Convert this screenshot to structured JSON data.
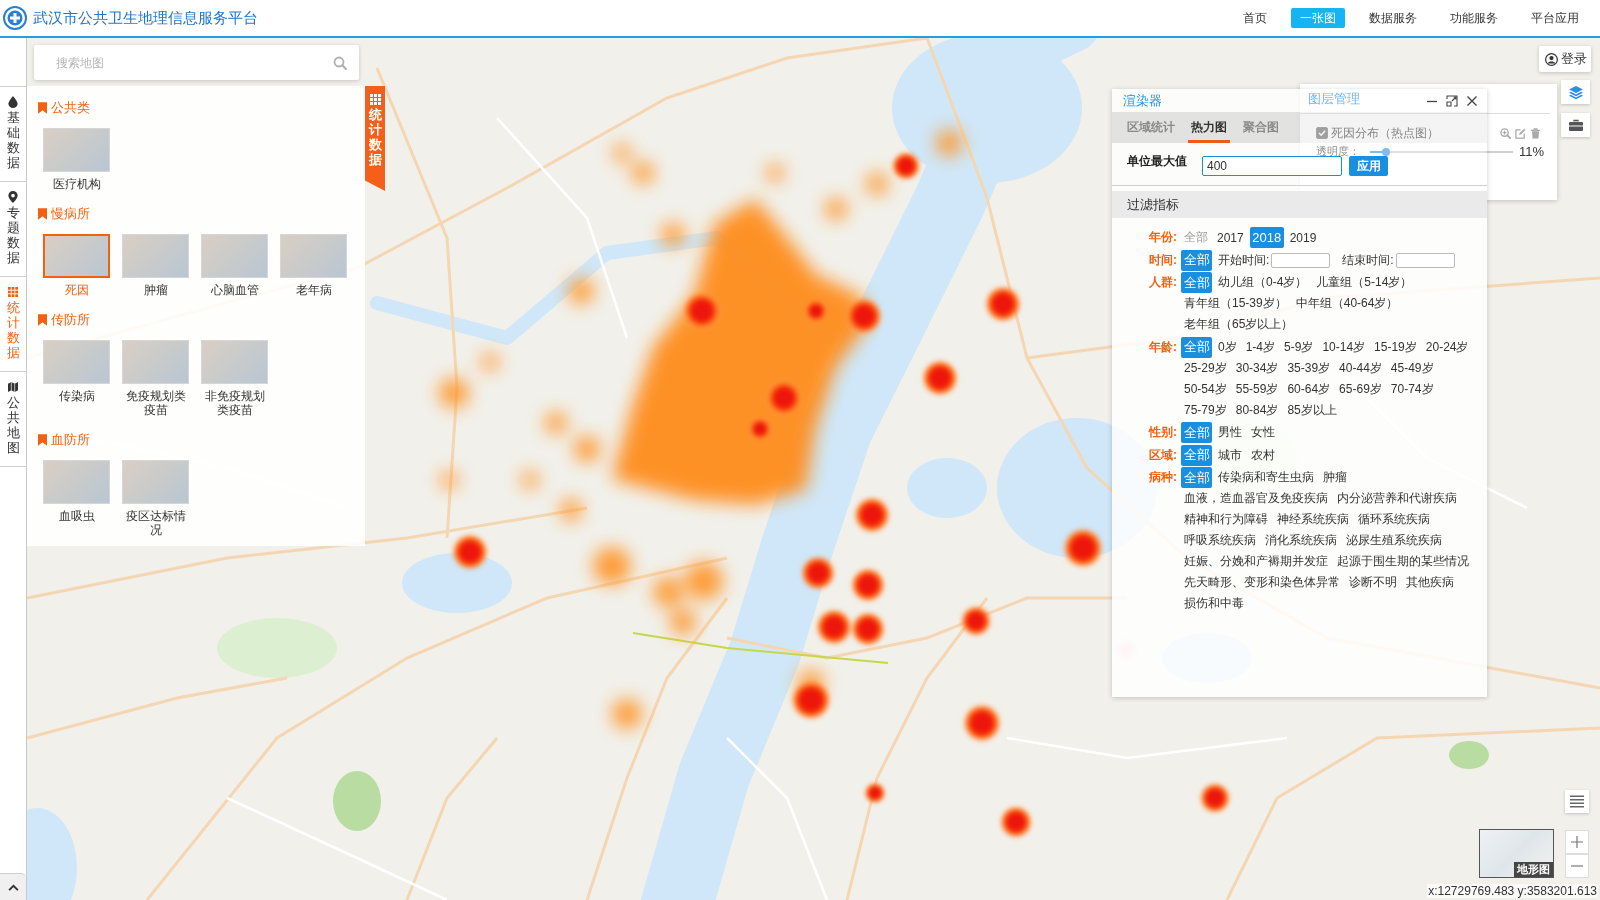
{
  "header": {
    "title": "武汉市公共卫生地理信息服务平台",
    "nav": [
      {
        "label": "首页",
        "selected": false
      },
      {
        "label": "一张图",
        "selected": true
      },
      {
        "label": "数据服务",
        "selected": false
      },
      {
        "label": "功能服务",
        "selected": false
      },
      {
        "label": "平台应用",
        "selected": false
      }
    ]
  },
  "sidebar": {
    "items": [
      {
        "kind": "drop",
        "label": "基础数据",
        "selected": false
      },
      {
        "kind": "pin",
        "label": "专题数据",
        "selected": false
      },
      {
        "kind": "grid",
        "label": "统计数据",
        "selected": true
      },
      {
        "kind": "map",
        "label": "公共地图",
        "selected": false
      }
    ]
  },
  "search": {
    "placeholder": "搜索地图"
  },
  "catalog": {
    "tab": {
      "label": "统计数据"
    },
    "sections": [
      {
        "title": "公共类",
        "items": [
          {
            "label": "医疗机构",
            "selected": false
          }
        ]
      },
      {
        "title": "慢病所",
        "items": [
          {
            "label": "死因",
            "selected": true
          },
          {
            "label": "肿瘤",
            "selected": false
          },
          {
            "label": "心脑血管",
            "selected": false
          },
          {
            "label": "老年病",
            "selected": false
          }
        ]
      },
      {
        "title": "传防所",
        "items": [
          {
            "label": "传染病",
            "selected": false
          },
          {
            "label": "免疫规划类疫苗",
            "selected": false
          },
          {
            "label": "非免疫规划类疫苗",
            "selected": false
          }
        ]
      },
      {
        "title": "血防所",
        "items": [
          {
            "label": "血吸虫",
            "selected": false
          },
          {
            "label": "疫区达标情况",
            "selected": false
          }
        ]
      }
    ]
  },
  "renderer": {
    "title": "渲染器",
    "tabs": [
      {
        "label": "区域统计",
        "selected": false
      },
      {
        "label": "热力图",
        "selected": true
      },
      {
        "label": "聚合图",
        "selected": false
      }
    ],
    "max_value": {
      "label": "单位最大值",
      "value": "400",
      "button": "应用"
    },
    "filter_title": "过滤指标",
    "filters": [
      {
        "label": "年份:",
        "items": [
          {
            "kind": "option",
            "label": "全部",
            "selected": false,
            "disabled": true
          },
          {
            "kind": "option",
            "label": "2017",
            "selected": false,
            "disabled": false
          },
          {
            "kind": "option",
            "label": "2018",
            "selected": true,
            "disabled": false
          },
          {
            "kind": "option",
            "label": "2019",
            "selected": false,
            "disabled": false
          }
        ]
      },
      {
        "label": "时间:",
        "items": [
          {
            "kind": "option",
            "label": "全部",
            "selected": true
          },
          {
            "kind": "date",
            "label": "开始时间:"
          },
          {
            "kind": "date",
            "label": "结束时间:"
          }
        ]
      },
      {
        "label": "人群:",
        "items": [
          {
            "kind": "option",
            "label": "全部",
            "selected": true
          },
          {
            "kind": "option",
            "label": "幼儿组（0-4岁）",
            "selected": false
          },
          {
            "kind": "option",
            "label": "儿童组（5-14岁）",
            "selected": false
          },
          {
            "kind": "option",
            "label": "青年组（15-39岁）",
            "selected": false
          },
          {
            "kind": "option",
            "label": "中年组（40-64岁）",
            "selected": false
          },
          {
            "kind": "option",
            "label": "老年组（65岁以上）",
            "selected": false
          }
        ]
      },
      {
        "label": "年龄:",
        "items": [
          {
            "kind": "option",
            "label": "全部",
            "selected": true
          },
          {
            "kind": "option",
            "label": "0岁",
            "selected": false
          },
          {
            "kind": "option",
            "label": "1-4岁",
            "selected": false
          },
          {
            "kind": "option",
            "label": "5-9岁",
            "selected": false
          },
          {
            "kind": "option",
            "label": "10-14岁",
            "selected": false
          },
          {
            "kind": "option",
            "label": "15-19岁",
            "selected": false
          },
          {
            "kind": "option",
            "label": "20-24岁",
            "selected": false
          },
          {
            "kind": "option",
            "label": "25-29岁",
            "selected": false
          },
          {
            "kind": "option",
            "label": "30-34岁",
            "selected": false
          },
          {
            "kind": "option",
            "label": "35-39岁",
            "selected": false
          },
          {
            "kind": "option",
            "label": "40-44岁",
            "selected": false
          },
          {
            "kind": "option",
            "label": "45-49岁",
            "selected": false
          },
          {
            "kind": "option",
            "label": "50-54岁",
            "selected": false
          },
          {
            "kind": "option",
            "label": "55-59岁",
            "selected": false
          },
          {
            "kind": "option",
            "label": "60-64岁",
            "selected": false
          },
          {
            "kind": "option",
            "label": "65-69岁",
            "selected": false
          },
          {
            "kind": "option",
            "label": "70-74岁",
            "selected": false
          },
          {
            "kind": "option",
            "label": "75-79岁",
            "selected": false
          },
          {
            "kind": "option",
            "label": "80-84岁",
            "selected": false
          },
          {
            "kind": "option",
            "label": "85岁以上",
            "selected": false
          }
        ]
      },
      {
        "label": "性别:",
        "items": [
          {
            "kind": "option",
            "label": "全部",
            "selected": true
          },
          {
            "kind": "option",
            "label": "男性",
            "selected": false
          },
          {
            "kind": "option",
            "label": "女性",
            "selected": false
          }
        ]
      },
      {
        "label": "区域:",
        "items": [
          {
            "kind": "option",
            "label": "全部",
            "selected": true
          },
          {
            "kind": "option",
            "label": "城市",
            "selected": false
          },
          {
            "kind": "option",
            "label": "农村",
            "selected": false
          }
        ]
      },
      {
        "label": "病种:",
        "items": [
          {
            "kind": "option",
            "label": "全部",
            "selected": true
          },
          {
            "kind": "option",
            "label": "传染病和寄生虫病",
            "selected": false
          },
          {
            "kind": "option",
            "label": "肿瘤",
            "selected": false
          },
          {
            "kind": "option",
            "label": "血液，造血器官及免疫疾病",
            "selected": false
          },
          {
            "kind": "option",
            "label": "内分泌营养和代谢疾病",
            "selected": false
          },
          {
            "kind": "option",
            "label": "精神和行为障碍",
            "selected": false
          },
          {
            "kind": "option",
            "label": "神经系统疾病",
            "selected": false
          },
          {
            "kind": "option",
            "label": "循环系统疾病",
            "selected": false
          },
          {
            "kind": "option",
            "label": "呼吸系统疾病",
            "selected": false
          },
          {
            "kind": "option",
            "label": "消化系统疾病",
            "selected": false
          },
          {
            "kind": "option",
            "label": "泌尿生殖系统疾病",
            "selected": false
          },
          {
            "kind": "option",
            "label": "妊娠、分娩和产褥期并发症",
            "selected": false
          },
          {
            "kind": "option",
            "label": "起源于围生期的某些情况",
            "selected": false
          },
          {
            "kind": "option",
            "label": "先天畸形、变形和染色体异常",
            "selected": false
          },
          {
            "kind": "option",
            "label": "诊断不明",
            "selected": false
          },
          {
            "kind": "option",
            "label": "其他疾病",
            "selected": false
          },
          {
            "kind": "option",
            "label": "损伤和中毒",
            "selected": false
          }
        ]
      }
    ]
  },
  "layer_panel": {
    "title": "图层管理",
    "layers": [
      {
        "name": "死因分布（热点图）",
        "checked": true,
        "opacity_label": "透明度：",
        "level": 0.11,
        "reading": "11%"
      }
    ]
  },
  "account": {
    "login": "登录"
  },
  "basemap": {
    "label": "地形图"
  },
  "coordinates": "x:12729769.483 y:3583201.613"
}
